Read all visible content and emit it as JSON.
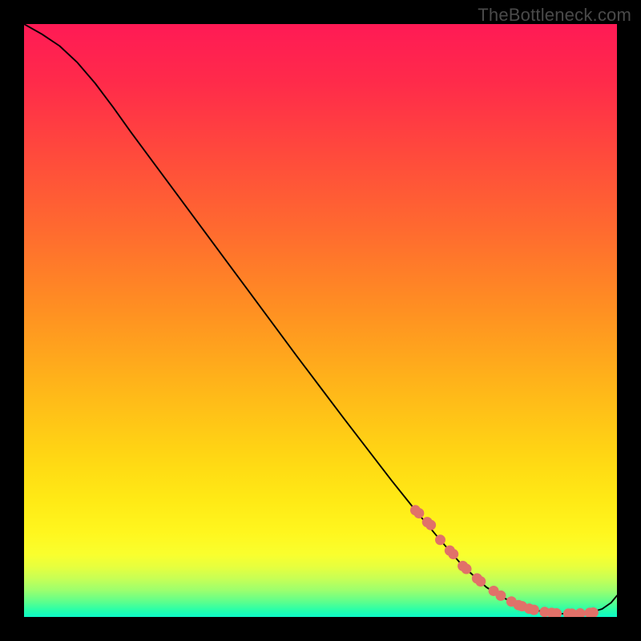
{
  "watermark": "TheBottleneck.com",
  "chart_data": {
    "type": "line",
    "title": "",
    "xlabel": "",
    "ylabel": "",
    "xlim": [
      0,
      100
    ],
    "ylim": [
      0,
      100
    ],
    "gradient_stops": [
      {
        "offset": 0.0,
        "color": "#ff1a55"
      },
      {
        "offset": 0.1,
        "color": "#ff2b4a"
      },
      {
        "offset": 0.22,
        "color": "#ff4a3c"
      },
      {
        "offset": 0.35,
        "color": "#ff6b2f"
      },
      {
        "offset": 0.48,
        "color": "#ff8f22"
      },
      {
        "offset": 0.6,
        "color": "#ffb21a"
      },
      {
        "offset": 0.72,
        "color": "#ffd414"
      },
      {
        "offset": 0.8,
        "color": "#ffe915"
      },
      {
        "offset": 0.86,
        "color": "#fff71f"
      },
      {
        "offset": 0.895,
        "color": "#f9ff2e"
      },
      {
        "offset": 0.915,
        "color": "#e7ff3e"
      },
      {
        "offset": 0.935,
        "color": "#c7ff55"
      },
      {
        "offset": 0.955,
        "color": "#9cff6e"
      },
      {
        "offset": 0.975,
        "color": "#5bff8e"
      },
      {
        "offset": 0.99,
        "color": "#22ffad"
      },
      {
        "offset": 1.0,
        "color": "#0cf8c8"
      }
    ],
    "series": [
      {
        "name": "curve",
        "x": [
          0.0,
          3.0,
          6.0,
          9.0,
          12.0,
          15.0,
          18.0,
          22.0,
          26.0,
          30.0,
          34.0,
          38.0,
          42.0,
          46.0,
          50.0,
          54.0,
          58.0,
          62.0,
          66.0,
          70.0,
          74.0,
          78.0,
          82.0,
          85.0,
          88.0,
          90.5,
          93.0,
          95.5,
          97.5,
          99.0,
          100.0
        ],
        "y": [
          100.0,
          98.3,
          96.3,
          93.5,
          90.0,
          86.0,
          81.8,
          76.4,
          71.0,
          65.6,
          60.2,
          54.8,
          49.4,
          44.0,
          38.7,
          33.4,
          28.2,
          23.0,
          18.0,
          13.2,
          8.6,
          5.0,
          2.6,
          1.4,
          0.8,
          0.55,
          0.55,
          0.75,
          1.35,
          2.4,
          3.6
        ]
      }
    ],
    "markers": {
      "name": "dots",
      "color": "#e17169",
      "radius": 6.5,
      "x": [
        66.0,
        66.6,
        68.0,
        68.6,
        70.2,
        71.8,
        72.4,
        74.0,
        74.6,
        76.4,
        77.0,
        79.2,
        80.4,
        82.2,
        83.4,
        84.0,
        85.2,
        86.0,
        87.8,
        89.0,
        89.8,
        91.8,
        92.4,
        93.8,
        95.4,
        96.0
      ],
      "y": [
        18.0,
        17.5,
        16.0,
        15.5,
        13.0,
        11.2,
        10.6,
        8.6,
        8.1,
        6.5,
        6.0,
        4.4,
        3.6,
        2.6,
        2.0,
        1.8,
        1.4,
        1.2,
        0.85,
        0.7,
        0.6,
        0.55,
        0.55,
        0.6,
        0.7,
        0.75
      ]
    }
  }
}
